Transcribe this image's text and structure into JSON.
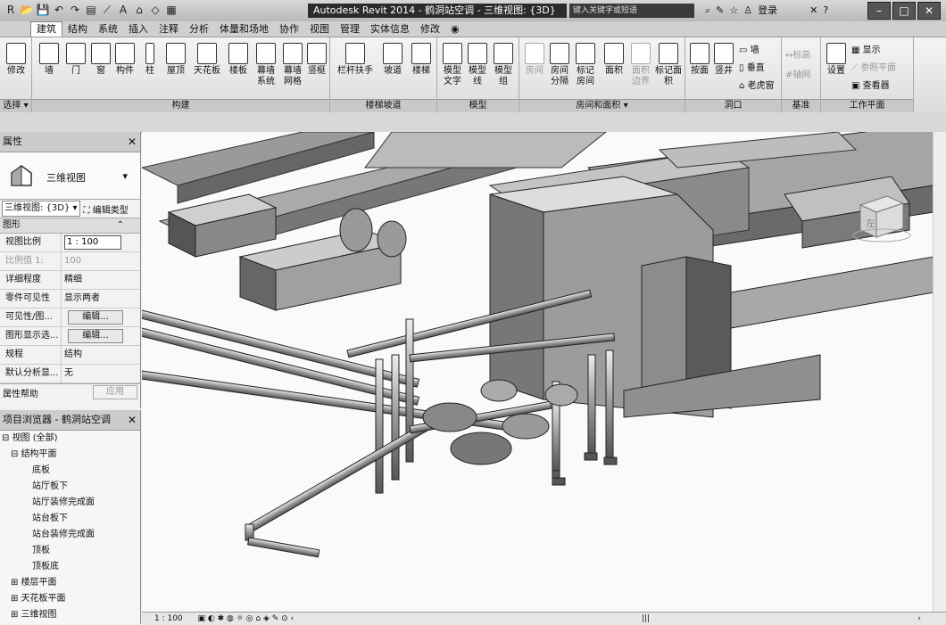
{
  "titlebar": {
    "app_title": "Autodesk Revit 2014 -   鹤洞站空调 - 三维视图: {3D}",
    "search_placeholder": "键入关键字或短语",
    "login": "登录",
    "help": "?"
  },
  "menubar": [
    "建筑",
    "结构",
    "系统",
    "插入",
    "注释",
    "分析",
    "体量和场地",
    "协作",
    "视图",
    "管理",
    "实体信息",
    "修改"
  ],
  "ribbon": {
    "select": {
      "btn": "修改",
      "label": "选择 ▾"
    },
    "build": {
      "label": "构建",
      "btns": [
        "墙",
        "门",
        "窗",
        "构件",
        "柱",
        "屋顶",
        "天花板",
        "楼板",
        "幕墙系统",
        "幕墙网格",
        "竖梃"
      ]
    },
    "stairs": {
      "label": "楼梯坡道",
      "btns": [
        "栏杆扶手",
        "坡道",
        "楼梯"
      ]
    },
    "model": {
      "label": "模型",
      "btns": [
        "模型文字",
        "模型线",
        "模型组"
      ]
    },
    "room": {
      "label": "房间和面积 ▾",
      "btns": [
        "房间",
        "房间分隔",
        "标记房间",
        "面积",
        "面积边界",
        "标记面积"
      ]
    },
    "opening": {
      "label": "洞口",
      "btns": [
        "按面",
        "竖井"
      ],
      "small": [
        "墙",
        "垂直",
        "老虎窗"
      ]
    },
    "datum": {
      "label": "基准",
      "small": [
        "标高",
        "轴网"
      ]
    },
    "workplane": {
      "label": "工作平面",
      "btn": "设置",
      "small": [
        "显示",
        "参照平面",
        "查看器"
      ]
    }
  },
  "properties": {
    "title": "属性",
    "type_name": "三维视图",
    "view_selector": "三维视图: {3D}",
    "edit_type": "编辑类型",
    "section": "图形",
    "rows": [
      {
        "k": "视图比例",
        "v": "1 : 100"
      },
      {
        "k": "比例值 1:",
        "v": "100"
      },
      {
        "k": "详细程度",
        "v": "精细"
      },
      {
        "k": "零件可见性",
        "v": "显示两者"
      },
      {
        "k": "可见性/图...",
        "v": "编辑..."
      },
      {
        "k": "图形显示选...",
        "v": "编辑..."
      },
      {
        "k": "规程",
        "v": "结构"
      },
      {
        "k": "默认分析显...",
        "v": "无"
      }
    ],
    "help": "属性帮助",
    "apply": "应用"
  },
  "browser": {
    "title": "项目浏览器 - 鹤洞站空调",
    "tree": [
      {
        "t": "视图 (全部)",
        "lvl": 0
      },
      {
        "t": "结构平面",
        "lvl": 1
      },
      {
        "t": "底板",
        "lvl": 2
      },
      {
        "t": "站厅板下",
        "lvl": 2
      },
      {
        "t": "站厅装修完成面",
        "lvl": 2
      },
      {
        "t": "站台板下",
        "lvl": 2
      },
      {
        "t": "站台装修完成面",
        "lvl": 2
      },
      {
        "t": "顶板",
        "lvl": 2
      },
      {
        "t": "顶板底",
        "lvl": 2
      },
      {
        "t": "楼层平面",
        "lvl": 1
      },
      {
        "t": "天花板平面",
        "lvl": 1
      },
      {
        "t": "三维视图",
        "lvl": 1
      }
    ]
  },
  "viewport": {
    "cube_label": "左",
    "scale": "1 : 100"
  }
}
